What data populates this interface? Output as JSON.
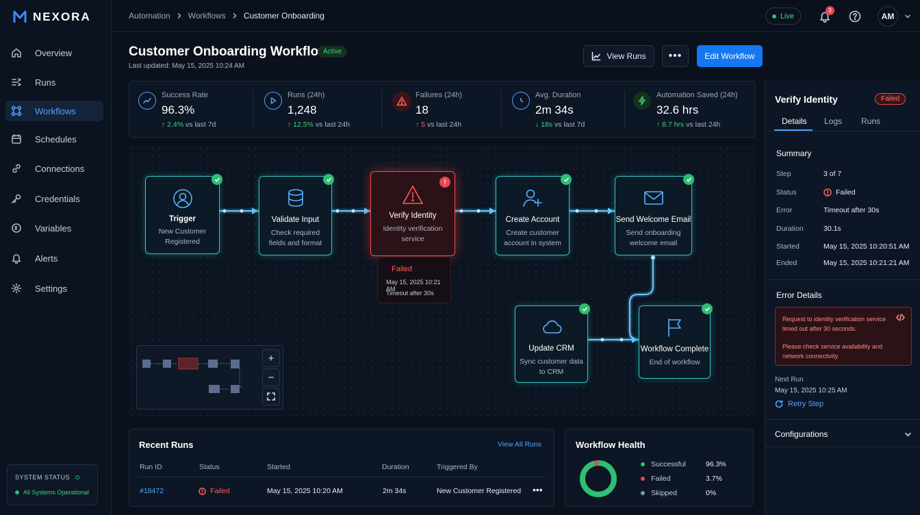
{
  "brand": {
    "name": "NEXORA",
    "accent": "#1478f0"
  },
  "sidebar": {
    "items": [
      {
        "label": "Overview",
        "icon": "home-icon"
      },
      {
        "label": "Runs",
        "icon": "runs-icon"
      },
      {
        "label": "Workflows",
        "icon": "workflow-icon",
        "active": true
      },
      {
        "label": "Schedules",
        "icon": "calendar-icon"
      },
      {
        "label": "Connections",
        "icon": "link-icon"
      },
      {
        "label": "Credentials",
        "icon": "key-icon"
      },
      {
        "label": "Variables",
        "icon": "variable-icon"
      },
      {
        "label": "Alerts",
        "icon": "bell-icon"
      },
      {
        "label": "Settings",
        "icon": "gear-icon"
      }
    ],
    "system_status": {
      "title": "SYSTEM STATUS",
      "text": "All Systems Operational"
    }
  },
  "topbar": {
    "breadcrumbs": [
      "Automation",
      "Workflows",
      "Customer Onboarding"
    ],
    "live_label": "Live",
    "notification_count": "3",
    "avatar_initials": "AM"
  },
  "header": {
    "title": "Customer Onboarding Workflow",
    "status": "Active",
    "last_updated": "Last updated: May 15, 2025 10:24 AM",
    "view_runs_label": "View Runs",
    "more_label": "•••",
    "edit_label": "Edit Workflow"
  },
  "stats": [
    {
      "label": "Success Rate",
      "value": "96.3%",
      "delta": "2.4%",
      "trend": "up",
      "compare": "vs last 7d",
      "color": "#4ea3ff"
    },
    {
      "label": "Runs (24h)",
      "value": "1,248",
      "delta": "12.5%",
      "trend": "up",
      "compare": "vs last 24h",
      "color": "#4ea3ff"
    },
    {
      "label": "Failures (24h)",
      "value": "18",
      "delta": "5",
      "trend": "up-bad",
      "compare": "vs last 24h",
      "color": "#ff5c5c"
    },
    {
      "label": "Avg. Duration",
      "value": "2m 34s",
      "delta": "18s",
      "trend": "down",
      "compare": "vs last 7d",
      "color": "#4ea3ff"
    },
    {
      "label": "Automation Saved (24h)",
      "value": "32.6 hrs",
      "delta": "8.7 hrs",
      "trend": "up",
      "compare": "vs last 24h",
      "color": "#3ed37f"
    }
  ],
  "workflow": {
    "nodes": [
      {
        "title": "Trigger",
        "desc": "New Customer Registered",
        "status": "success",
        "icon": "user-icon"
      },
      {
        "title": "Validate Input",
        "desc": "Check required fields and format",
        "status": "success",
        "icon": "database-icon"
      },
      {
        "title": "Verify Identity",
        "desc": "Identity verification service",
        "status": "failed",
        "icon": "warning-icon"
      },
      {
        "title": "Create Account",
        "desc": "Create customer account in system",
        "status": "success",
        "icon": "user-plus-icon"
      },
      {
        "title": "Send Welcome Email",
        "desc": "Send onboarding welcome email",
        "status": "success",
        "icon": "mail-icon"
      },
      {
        "title": "Update CRM",
        "desc": "Sync customer data to CRM",
        "status": "success",
        "icon": "cloud-icon"
      },
      {
        "title": "Workflow Complete",
        "desc": "End of workflow",
        "status": "success",
        "icon": "flag-icon"
      }
    ],
    "failure": {
      "label": "Failed",
      "time": "May 15, 2025 10:21 AM",
      "error": "Timeout after 30s"
    },
    "zoom": {
      "in": "+",
      "out": "−"
    }
  },
  "recent_runs": {
    "title": "Recent Runs",
    "view_all": "View All Runs",
    "columns": [
      "Run ID",
      "Status",
      "Started",
      "Duration",
      "Triggered By"
    ],
    "rows": [
      {
        "id": "#18472",
        "status": "Failed",
        "started": "May 15, 2025 10:20 AM",
        "duration": "2m 34s",
        "triggered_by": "New Customer Registered"
      }
    ]
  },
  "health": {
    "title": "Workflow Health",
    "items": [
      {
        "label": "Successful",
        "value": "96.3%",
        "pct": 96.3,
        "color": "#2fbf71"
      },
      {
        "label": "Failed",
        "value": "3.7%",
        "pct": 3.7,
        "color": "#e5484d"
      },
      {
        "label": "Skipped",
        "value": "0%",
        "pct": 0,
        "color": "#8a96a8"
      }
    ]
  },
  "panel": {
    "title": "Verify Identity",
    "badge": "Failed",
    "tabs": [
      "Details",
      "Logs",
      "Runs"
    ],
    "summary_title": "Summary",
    "summary": [
      {
        "k": "Step",
        "v": "3 of 7"
      },
      {
        "k": "Status",
        "v": "Failed"
      },
      {
        "k": "Error",
        "v": "Timeout after 30s"
      },
      {
        "k": "Duration",
        "v": "30.1s"
      },
      {
        "k": "Started",
        "v": "May 15, 2025 10:20:51 AM"
      },
      {
        "k": "Ended",
        "v": "May 15, 2025 10:21:21 AM"
      }
    ],
    "error_title": "Error Details",
    "error_msg1": "Request to identity verification service timed out after 30 seconds.",
    "error_msg2": "Please check service availability and network connectivity.",
    "next_run_label": "Next Run",
    "next_run_value": "May 15, 2025 10:25 AM",
    "retry_label": "Retry Step",
    "config_label": "Configurations"
  }
}
